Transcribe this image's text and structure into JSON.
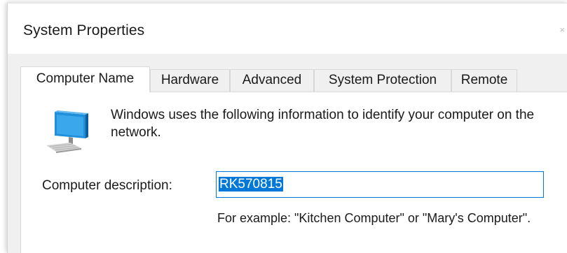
{
  "window": {
    "title": "System Properties",
    "close_glyph": "×"
  },
  "tabs": [
    {
      "label": "Computer Name",
      "active": true
    },
    {
      "label": "Hardware",
      "active": false
    },
    {
      "label": "Advanced",
      "active": false
    },
    {
      "label": "System Protection",
      "active": false
    },
    {
      "label": "Remote",
      "active": false
    }
  ],
  "computer_name_tab": {
    "icon": "computer-monitor-icon",
    "intro_text": "Windows uses the following information to identify your computer on the network.",
    "description_label": "Computer description:",
    "description_value": "RK570815",
    "description_selected": true,
    "example_text": "For example: \"Kitchen Computer\" or \"Mary's Computer\"."
  },
  "colors": {
    "accent": "#0078d7",
    "dialog_background": "#f0f0f0",
    "panel_background": "#ffffff",
    "tab_border": "#d9d9d9"
  }
}
